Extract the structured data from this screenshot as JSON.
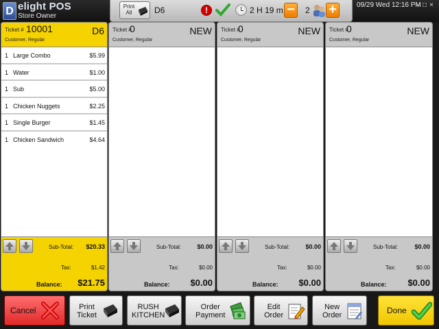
{
  "app": {
    "logo_mark": "D",
    "name": "elight POS",
    "role": "Store Owner"
  },
  "statusbar": {
    "print_all_label": "Print All",
    "table_code": "D6",
    "alert_symbol": "!",
    "elapsed": "2 H 19 m",
    "minus_symbol": "−",
    "guest_count": "2",
    "plus_symbol": "+"
  },
  "system": {
    "datetime": "09/29 Wed 12:16 PM",
    "minimize": "–",
    "maximize": "□",
    "close": "×"
  },
  "tickets": [
    {
      "ticket_label": "Ticket #",
      "number": "10001",
      "status": "D6",
      "customer": "Customer, Regular",
      "items": [
        {
          "qty": "1",
          "name": "Large Combo",
          "price": "$5.99"
        },
        {
          "qty": "1",
          "name": "Water",
          "price": "$1.00"
        },
        {
          "qty": "1",
          "name": "Sub",
          "price": "$5.00"
        },
        {
          "qty": "1",
          "name": "Chicken Nuggets",
          "price": "$2.25"
        },
        {
          "qty": "1",
          "name": "Single Burger",
          "price": "$1.45"
        },
        {
          "qty": "1",
          "name": "Chicken Sandwich",
          "price": "$4.64"
        }
      ],
      "subtotal_label": "Sub-Total:",
      "subtotal": "$20.33",
      "tax_label": "Tax:",
      "tax": "$1.42",
      "balance_label": "Balance:",
      "balance": "$21.75"
    },
    {
      "ticket_label": "Ticket #",
      "number": "0",
      "status": "NEW",
      "customer": "Customer, Regular",
      "subtotal_label": "Sub-Total:",
      "subtotal": "$0.00",
      "tax_label": "Tax:",
      "tax": "$0.00",
      "balance_label": "Balance:",
      "balance": "$0.00"
    },
    {
      "ticket_label": "Ticket #",
      "number": "0",
      "status": "NEW",
      "customer": "Customer, Regular",
      "subtotal_label": "Sub-Total:",
      "subtotal": "$0.00",
      "tax_label": "Tax:",
      "tax": "$0.00",
      "balance_label": "Balance:",
      "balance": "$0.00"
    },
    {
      "ticket_label": "Ticket #",
      "number": "0",
      "status": "NEW",
      "customer": "Customer, Regular",
      "subtotal_label": "Sub-Total:",
      "subtotal": "$0.00",
      "tax_label": "Tax:",
      "tax": "$0.00",
      "balance_label": "Balance:",
      "balance": "$0.00"
    }
  ],
  "toolbar": {
    "cancel": "Cancel",
    "print_line1": "Print",
    "print_line2": "Ticket",
    "rush_line1": "RUSH",
    "rush_line2": "KITCHEN",
    "pay_line1": "Order",
    "pay_line2": "Payment",
    "edit_line1": "Edit",
    "edit_line2": "Order",
    "new_line1": "New",
    "new_line2": "Order",
    "done": "Done"
  },
  "colors": {
    "active_ticket": "#f5d300",
    "inactive_ticket": "#c8c8c8",
    "cancel": "#e12a2a",
    "done": "#f0c600",
    "accent_orange": "#ef7c00"
  }
}
